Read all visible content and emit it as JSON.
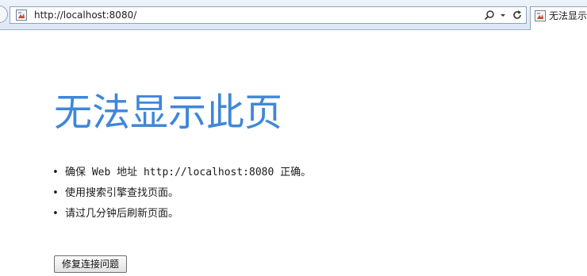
{
  "browser": {
    "address_bar": {
      "url": "http://localhost:8080/"
    },
    "tab": {
      "title": "无法显示此页"
    }
  },
  "page": {
    "heading": "无法显示此页",
    "suggestions": [
      {
        "text": "确保 Web 地址 http://localhost:8080 正确。"
      },
      {
        "text": "使用搜索引擎查找页面。"
      },
      {
        "text": "请过几分钟后刷新页面。"
      }
    ],
    "fix_button_label": "修复连接问题"
  },
  "icons": {
    "address_bar": [
      "page-icon",
      "search-icon",
      "dropdown-icon",
      "refresh-icon"
    ],
    "tab": [
      "page-icon"
    ]
  },
  "colors": {
    "heading": "#3f87d9",
    "chrome": "#dde7f3"
  }
}
